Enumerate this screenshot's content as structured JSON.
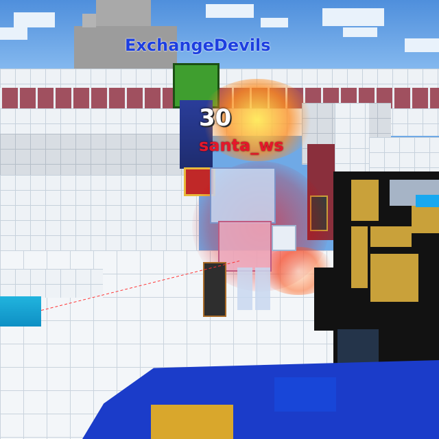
{
  "game": {
    "players": [
      {
        "name": "ExchangeDevils",
        "team": "ally",
        "name_color": "#1d3fe0"
      },
      {
        "name": "santa_ws",
        "team": "enemy",
        "name_color": "#e5172a"
      }
    ],
    "hit": {
      "damage": "30"
    },
    "icons": [
      "crosshair-laser",
      "player-weapon"
    ]
  }
}
